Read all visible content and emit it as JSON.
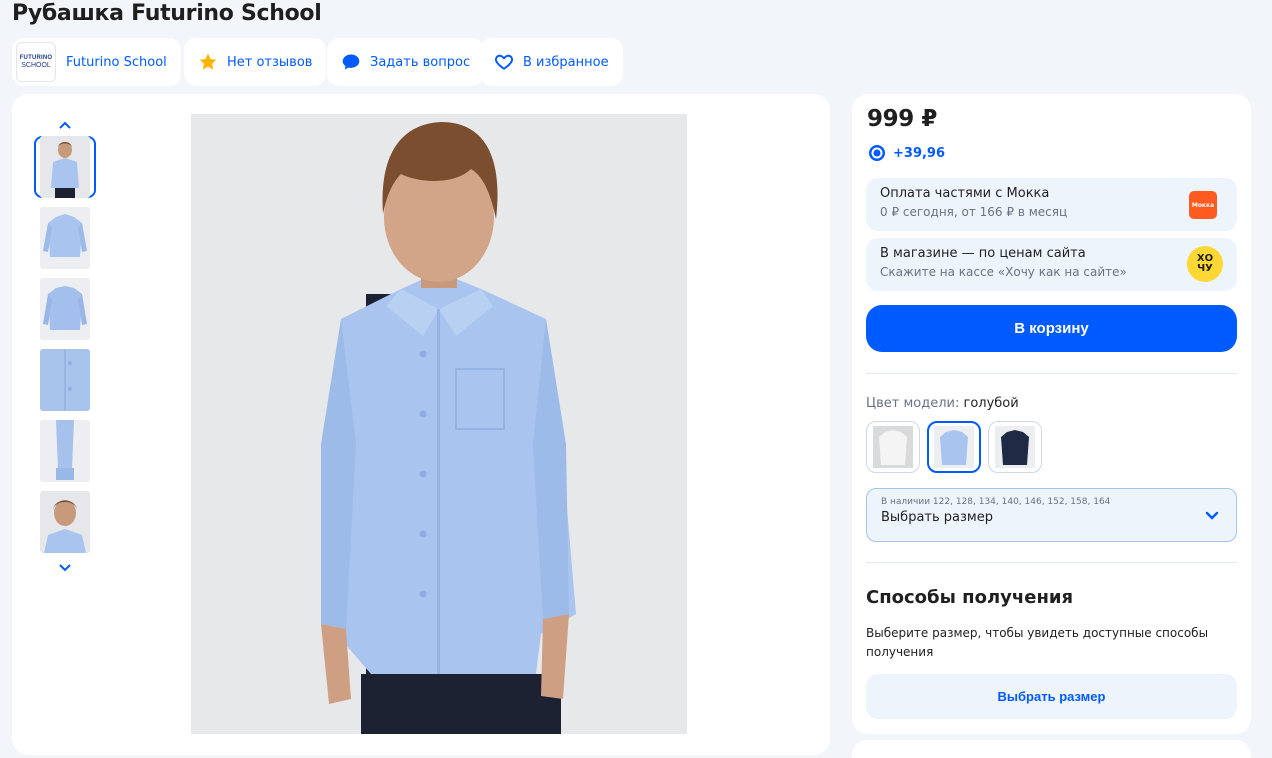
{
  "product": {
    "title": "Рубашка Futurino School"
  },
  "header": {
    "brand_logo_line1": "FUTURINO",
    "brand_logo_line2": "SCHOOL",
    "brand_name": "Futurino School",
    "reviews_label": "Нет отзывов",
    "ask_label": "Задать вопрос",
    "favorite_label": "В избранное"
  },
  "gallery": {
    "thumbnail_count": 6,
    "selected_index": 0
  },
  "pricing": {
    "price": "999 ₽",
    "bonus": "+39,96",
    "installments_title": "Оплата частями с Мокка",
    "installments_sub": "0 ₽ сегодня, от 166 ₽ в месяц",
    "installments_logo": "Мокка",
    "store_title": "В магазине — по ценам сайта",
    "store_sub": "Скажите на кассе «Хочу как на сайте»",
    "store_logo_top": "ХО",
    "store_logo_bottom": "ЧУ",
    "cart_button": "В корзину"
  },
  "variants": {
    "color_label": "Цвет модели:",
    "color_value": "голубой",
    "swatches": [
      {
        "name": "white",
        "color": "#f2f2f2",
        "selected": false
      },
      {
        "name": "light-blue",
        "color": "#a9c8ee",
        "selected": true
      },
      {
        "name": "navy",
        "color": "#1f2a44",
        "selected": false
      }
    ],
    "size_available": "В наличии 122, 128, 134, 140, 146, 152, 158, 164",
    "size_label": "Выбрать размер"
  },
  "delivery": {
    "heading": "Способы получения",
    "text": "Выберите размер, чтобы увидеть доступные способы получения",
    "button": "Выбрать размер"
  },
  "colors": {
    "accent": "#005bff",
    "background": "#f2f5f9",
    "promo_bg": "#eef4fc",
    "shirt": "#a9c4ee"
  }
}
